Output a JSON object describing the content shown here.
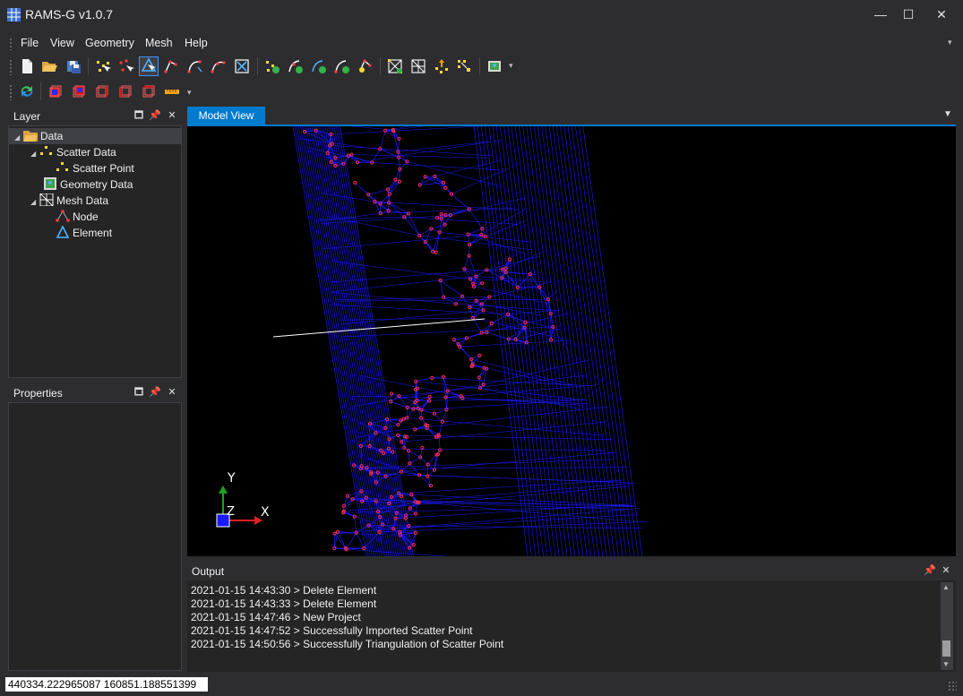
{
  "window": {
    "title": "RAMS-G v1.0.7",
    "controls": [
      "—",
      "☐",
      "✕"
    ]
  },
  "menu": [
    "File",
    "View",
    "Geometry",
    "Mesh",
    "Help"
  ],
  "layer_panel": {
    "title": "Layer",
    "tree": [
      {
        "label": "Data",
        "level": 0,
        "icon": "folder-icon",
        "selected": true
      },
      {
        "label": "Scatter Data",
        "level": 1,
        "icon": "scatter-data-icon"
      },
      {
        "label": "Scatter Point",
        "level": 2,
        "icon": "scatter-point-icon"
      },
      {
        "label": "Geometry Data",
        "level": 1,
        "icon": "geometry-data-icon"
      },
      {
        "label": "Mesh Data",
        "level": 1,
        "icon": "mesh-data-icon"
      },
      {
        "label": "Node",
        "level": 2,
        "icon": "node-icon"
      },
      {
        "label": "Element",
        "level": 2,
        "icon": "element-icon"
      }
    ]
  },
  "properties_panel": {
    "title": "Properties"
  },
  "tabs": {
    "model_view": "Model View"
  },
  "axes": {
    "x": "X",
    "y": "Y",
    "z": "Z"
  },
  "output": {
    "title": "Output",
    "lines": [
      "2021-01-15 14:43:30 > Delete Element",
      "2021-01-15 14:43:33 > Delete Element",
      "2021-01-15 14:47:46 > New Project",
      "2021-01-15 14:47:52 > Successfully Imported Scatter Point",
      "2021-01-15 14:50:56 > Successfully Triangulation of Scatter Point"
    ]
  },
  "status": {
    "coordinates": "440334.222965087 160851.188551399"
  },
  "colors": {
    "accent": "#007acc",
    "mesh": "#1a1aff",
    "node": "#ff2a4a"
  }
}
